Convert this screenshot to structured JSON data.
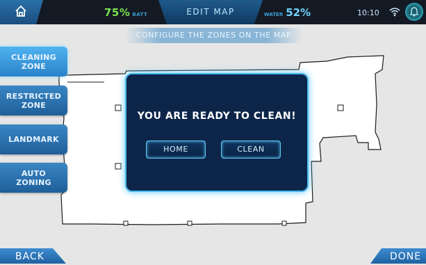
{
  "header": {
    "home_icon": "home-icon",
    "battery_value": "75%",
    "battery_label": "BATT",
    "title": "EDIT MAP",
    "water_label": "WATER",
    "water_value": "52%",
    "time": "10:10",
    "wifi_icon": "wifi-icon",
    "notification_icon": "bell-icon"
  },
  "subtitle": "CONFIGURE THE ZONES ON THE MAP",
  "tools": [
    {
      "label": "CLEANING\nZONE"
    },
    {
      "label": "RESTRICTED\nZONE"
    },
    {
      "label": "LANDMARK"
    },
    {
      "label": "AUTO\nZONING"
    }
  ],
  "dialog": {
    "message": "YOU ARE READY TO CLEAN!",
    "home_label": "HOME",
    "clean_label": "CLEAN"
  },
  "footer": {
    "back_label": "BACK",
    "done_label": "DONE"
  },
  "colors": {
    "accent": "#4ab8ec",
    "battery": "#7be04f",
    "dialog_bg": "#0c2548"
  }
}
